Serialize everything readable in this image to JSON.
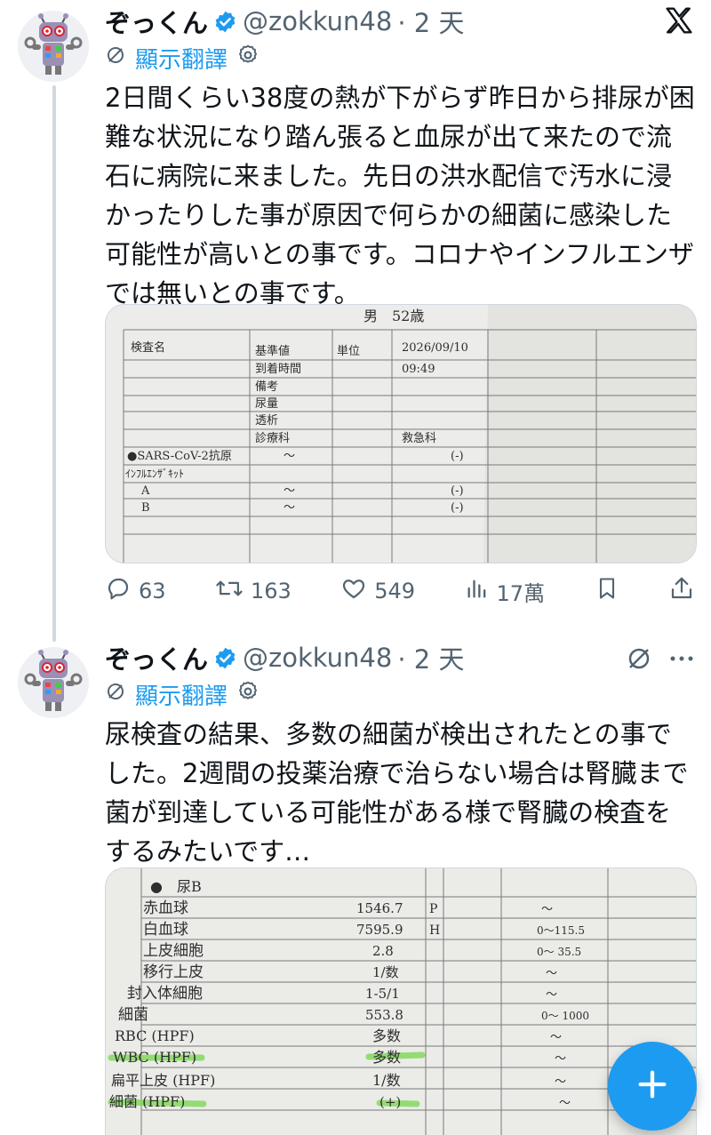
{
  "tweets": [
    {
      "author_name": "ぞっくん",
      "author_handle": "@zokkun48",
      "time": "· 2 天",
      "translate_label": "顯示翻譯",
      "text": "2日間くらい38度の熱が下がらず昨日から排尿が困難な状況になり踏ん張ると血尿が出て来たので流石に病院に来ました。先日の洪水配信で汚水に浸かったりした事が原因で何らかの細菌に感染した可能性が高いとの事です。コロナやインフルエンザでは無いとの事です。",
      "actions": {
        "replies": "63",
        "retweets": "163",
        "likes": "549",
        "views": "17萬"
      },
      "image": {
        "header": "男　52歳",
        "col_headers": [
          "検査名",
          "基準値",
          "単位",
          "2026/09/10"
        ],
        "info_rows": [
          {
            "label": "到着時間",
            "value": "09:49"
          },
          {
            "label": "備考",
            "value": ""
          },
          {
            "label": "尿量",
            "value": ""
          },
          {
            "label": "透析",
            "value": ""
          },
          {
            "label": "診療科",
            "value": "救急科"
          }
        ],
        "tests": [
          {
            "name": "●SARS-CoV-2抗原",
            "range": "～",
            "result": "(-)"
          },
          {
            "name": "ｲﾝﾌﾙｴﾝｻﾞｷｯﾄ",
            "range": "",
            "result": ""
          },
          {
            "name": "A",
            "range": "～",
            "result": "(-)"
          },
          {
            "name": "B",
            "range": "～",
            "result": "(-)"
          }
        ]
      }
    },
    {
      "author_name": "ぞっくん",
      "author_handle": "@zokkun48",
      "time": "· 2 天",
      "translate_label": "顯示翻譯",
      "text": "尿検査の結果、多数の細菌が検出されたとの事でした。2週間の投薬治療で治らない場合は腎臓まで菌が到達している可能性がある様で腎臓の検査をするみたいです…",
      "image": {
        "section": "●　尿B",
        "rows": [
          {
            "name": "赤血球",
            "value": "1546.7",
            "flag": "P",
            "range": "～"
          },
          {
            "name": "白血球",
            "value": "7595.9",
            "flag": "H",
            "range": "0～115.5"
          },
          {
            "name": "上皮細胞",
            "value": "2.8",
            "flag": "",
            "range": "0～ 35.5"
          },
          {
            "name": "移行上皮",
            "value": "1/数",
            "flag": "",
            "range": "～"
          },
          {
            "name": "封入体細胞",
            "value": "1-5/1",
            "flag": "",
            "range": "～"
          },
          {
            "name": "細菌",
            "value": "553.8",
            "flag": "",
            "range": "0～ 1000"
          },
          {
            "name": "RBC (HPF)",
            "value": "多数",
            "flag": "",
            "range": "～"
          },
          {
            "name": "WBC (HPF)",
            "value": "多数",
            "flag": "",
            "range": "～"
          },
          {
            "name": "扁平上皮 (HPF)",
            "value": "1/数",
            "flag": "",
            "range": "～"
          },
          {
            "name": "細菌 (HPF)",
            "value": "(+)",
            "flag": "",
            "range": "～"
          }
        ]
      }
    }
  ],
  "colors": {
    "accent": "#1d9bf0",
    "muted": "#536471",
    "highlighter": "#7ed957"
  },
  "icons": [
    "x-logo-icon",
    "grok-icon",
    "more-icon",
    "verified-badge-icon",
    "translate-icon",
    "settings-icon",
    "reply-icon",
    "retweet-icon",
    "like-icon",
    "views-icon",
    "bookmark-icon",
    "share-icon",
    "compose-icon"
  ]
}
